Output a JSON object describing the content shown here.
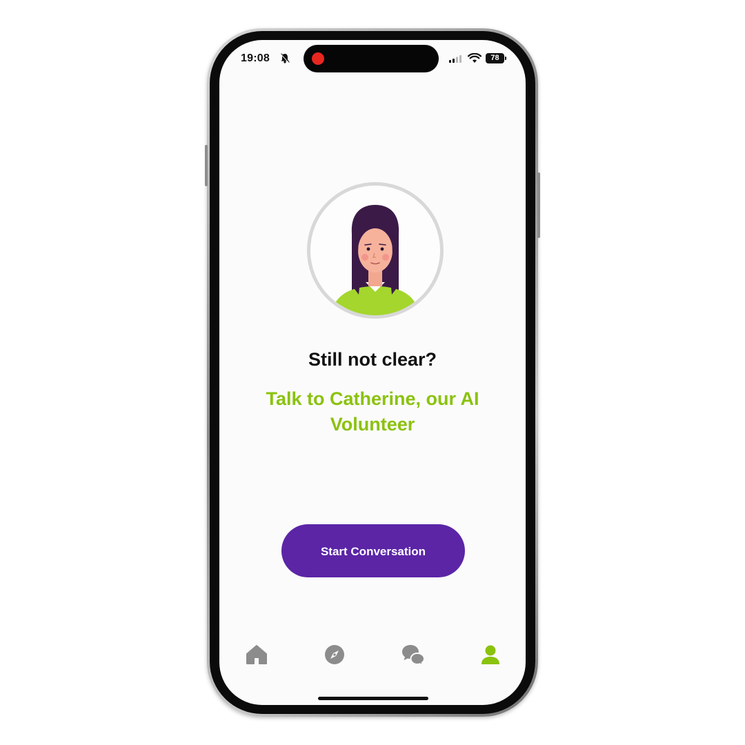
{
  "status_bar": {
    "time": "19:08",
    "battery": "78",
    "icons": [
      "bell-off-icon",
      "signal-icon",
      "wifi-icon",
      "battery-icon"
    ]
  },
  "main": {
    "avatar": "assistant-avatar-catherine",
    "heading": "Still not clear?",
    "subheading": "Talk to Catherine, our AI Volunteer",
    "cta_label": "Start Conversation"
  },
  "tab_bar": {
    "items": [
      {
        "icon": "home-icon",
        "active": false
      },
      {
        "icon": "compass-icon",
        "active": false
      },
      {
        "icon": "chat-icon",
        "active": false
      },
      {
        "icon": "profile-icon",
        "active": true
      }
    ]
  },
  "colors": {
    "accent_green": "#8bc20e",
    "button_purple": "#5b25a6",
    "inactive_icon": "#8c8c8c"
  }
}
